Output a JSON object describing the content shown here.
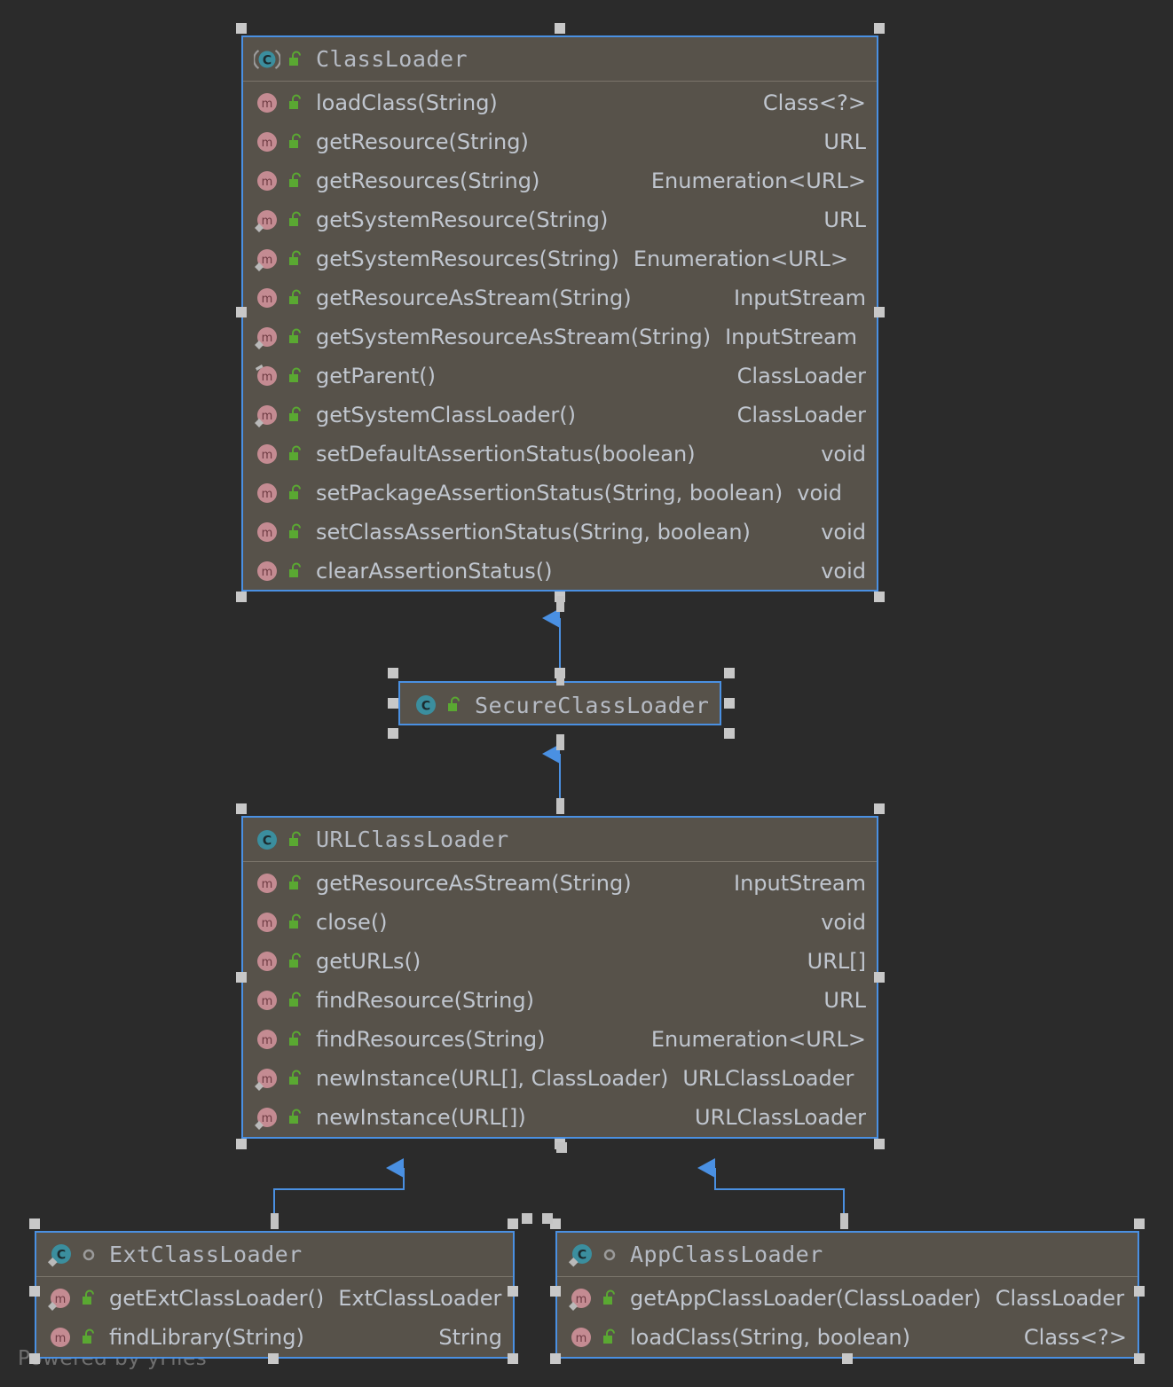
{
  "canvas": {
    "background": "#2b2b2b",
    "node_fill": "#57524a",
    "node_border": "#4a90e2",
    "edge_color": "#4a90e2",
    "text_color": "#c0c6cf",
    "handle_color": "#c8c8c8",
    "watermark": "Powered by yFiles"
  },
  "nodes": [
    {
      "id": "classloader",
      "name": "ClassLoader",
      "icon": "abstract-class-icon",
      "visibility": "public-lock-icon",
      "members": [
        {
          "signature": "loadClass(String)",
          "type": "Class<?>",
          "icon": "method-icon",
          "visibility": "public-lock-icon",
          "modifier": "none"
        },
        {
          "signature": "getResource(String)",
          "type": "URL",
          "icon": "method-icon",
          "visibility": "public-lock-icon",
          "modifier": "none"
        },
        {
          "signature": "getResources(String)",
          "type": "Enumeration<URL>",
          "icon": "method-icon",
          "visibility": "public-lock-icon",
          "modifier": "none"
        },
        {
          "signature": "getSystemResource(String)",
          "type": "URL",
          "icon": "method-icon",
          "visibility": "public-lock-icon",
          "modifier": "static"
        },
        {
          "signature": "getSystemResources(String)",
          "type": "Enumeration<URL>",
          "icon": "method-icon",
          "visibility": "public-lock-icon",
          "modifier": "static"
        },
        {
          "signature": "getResourceAsStream(String)",
          "type": "InputStream",
          "icon": "method-icon",
          "visibility": "public-lock-icon",
          "modifier": "none"
        },
        {
          "signature": "getSystemResourceAsStream(String)",
          "type": "InputStream",
          "icon": "method-icon",
          "visibility": "public-lock-icon",
          "modifier": "static"
        },
        {
          "signature": "getParent()",
          "type": "ClassLoader",
          "icon": "method-icon",
          "visibility": "public-lock-icon",
          "modifier": "final"
        },
        {
          "signature": "getSystemClassLoader()",
          "type": "ClassLoader",
          "icon": "method-icon",
          "visibility": "public-lock-icon",
          "modifier": "static"
        },
        {
          "signature": "setDefaultAssertionStatus(boolean)",
          "type": "void",
          "icon": "method-icon",
          "visibility": "public-lock-icon",
          "modifier": "none"
        },
        {
          "signature": "setPackageAssertionStatus(String, boolean)",
          "type": "void",
          "icon": "method-icon",
          "visibility": "public-lock-icon",
          "modifier": "none"
        },
        {
          "signature": "setClassAssertionStatus(String, boolean)",
          "type": "void",
          "icon": "method-icon",
          "visibility": "public-lock-icon",
          "modifier": "none"
        },
        {
          "signature": "clearAssertionStatus()",
          "type": "void",
          "icon": "method-icon",
          "visibility": "public-lock-icon",
          "modifier": "none"
        }
      ]
    },
    {
      "id": "secureclassloader",
      "name": "SecureClassLoader",
      "icon": "class-icon",
      "visibility": "public-lock-icon",
      "members": []
    },
    {
      "id": "urlclassloader",
      "name": "URLClassLoader",
      "icon": "class-icon",
      "visibility": "public-lock-icon",
      "members": [
        {
          "signature": "getResourceAsStream(String)",
          "type": "InputStream",
          "icon": "method-icon",
          "visibility": "public-lock-icon",
          "modifier": "none"
        },
        {
          "signature": "close()",
          "type": "void",
          "icon": "method-icon",
          "visibility": "public-lock-icon",
          "modifier": "none"
        },
        {
          "signature": "getURLs()",
          "type": "URL[]",
          "icon": "method-icon",
          "visibility": "public-lock-icon",
          "modifier": "none"
        },
        {
          "signature": "findResource(String)",
          "type": "URL",
          "icon": "method-icon",
          "visibility": "public-lock-icon",
          "modifier": "none"
        },
        {
          "signature": "findResources(String)",
          "type": "Enumeration<URL>",
          "icon": "method-icon",
          "visibility": "public-lock-icon",
          "modifier": "none"
        },
        {
          "signature": "newInstance(URL[], ClassLoader)",
          "type": "URLClassLoader",
          "icon": "method-icon",
          "visibility": "public-lock-icon",
          "modifier": "static"
        },
        {
          "signature": "newInstance(URL[])",
          "type": "URLClassLoader",
          "icon": "method-icon",
          "visibility": "public-lock-icon",
          "modifier": "static"
        }
      ]
    },
    {
      "id": "extclassloader",
      "name": "ExtClassLoader",
      "icon": "static-class-icon",
      "visibility": "package-private-icon",
      "members": [
        {
          "signature": "getExtClassLoader()",
          "type": "ExtClassLoader",
          "icon": "method-icon",
          "visibility": "public-lock-icon",
          "modifier": "static"
        },
        {
          "signature": "findLibrary(String)",
          "type": "String",
          "icon": "method-icon",
          "visibility": "public-lock-icon",
          "modifier": "none"
        }
      ]
    },
    {
      "id": "appclassloader",
      "name": "AppClassLoader",
      "icon": "static-class-icon",
      "visibility": "package-private-icon",
      "members": [
        {
          "signature": "getAppClassLoader(ClassLoader)",
          "type": "ClassLoader",
          "icon": "method-icon",
          "visibility": "public-lock-icon",
          "modifier": "static"
        },
        {
          "signature": "loadClass(String, boolean)",
          "type": "Class<?>",
          "icon": "method-icon",
          "visibility": "public-lock-icon",
          "modifier": "none"
        }
      ]
    }
  ],
  "edges": [
    {
      "from": "secureclassloader",
      "to": "classloader",
      "kind": "generalization"
    },
    {
      "from": "urlclassloader",
      "to": "secureclassloader",
      "kind": "generalization"
    },
    {
      "from": "extclassloader",
      "to": "urlclassloader",
      "kind": "generalization"
    },
    {
      "from": "appclassloader",
      "to": "urlclassloader",
      "kind": "generalization"
    }
  ]
}
